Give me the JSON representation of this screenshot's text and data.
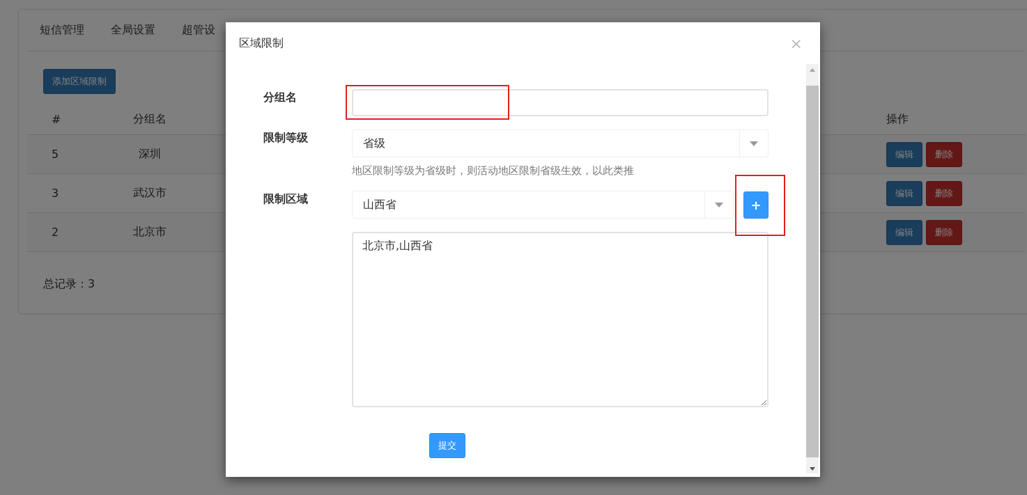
{
  "tabs": [
    {
      "label": "短信管理"
    },
    {
      "label": "全局设置"
    },
    {
      "label": "超管设"
    }
  ],
  "add_button": "添加区域限制",
  "table": {
    "columns": [
      "#",
      "分组名",
      "操作"
    ],
    "rows": [
      {
        "id": "5",
        "group": "深圳",
        "actions": [
          "编辑",
          "删除"
        ]
      },
      {
        "id": "3",
        "group": "武汉市",
        "actions": [
          "编辑",
          "删除"
        ]
      },
      {
        "id": "2",
        "group": "北京市",
        "actions": [
          "编辑",
          "删除"
        ]
      }
    ]
  },
  "total": "总记录：3",
  "dialog": {
    "title": "区域限制",
    "close": "×",
    "fields": [
      {
        "kind": "text",
        "label": "分组名",
        "highlighted": true
      },
      {
        "kind": "select",
        "label": "限制等级",
        "value": "省级",
        "help": "地区限制等级为省级时，则活动地区限制省级生效，以此类推"
      },
      {
        "kind": "select_add",
        "label": "限制区域",
        "value": "山西省",
        "add": "+",
        "highlighted": true,
        "textarea": "北京市,山西省"
      }
    ],
    "submit": "提交"
  }
}
